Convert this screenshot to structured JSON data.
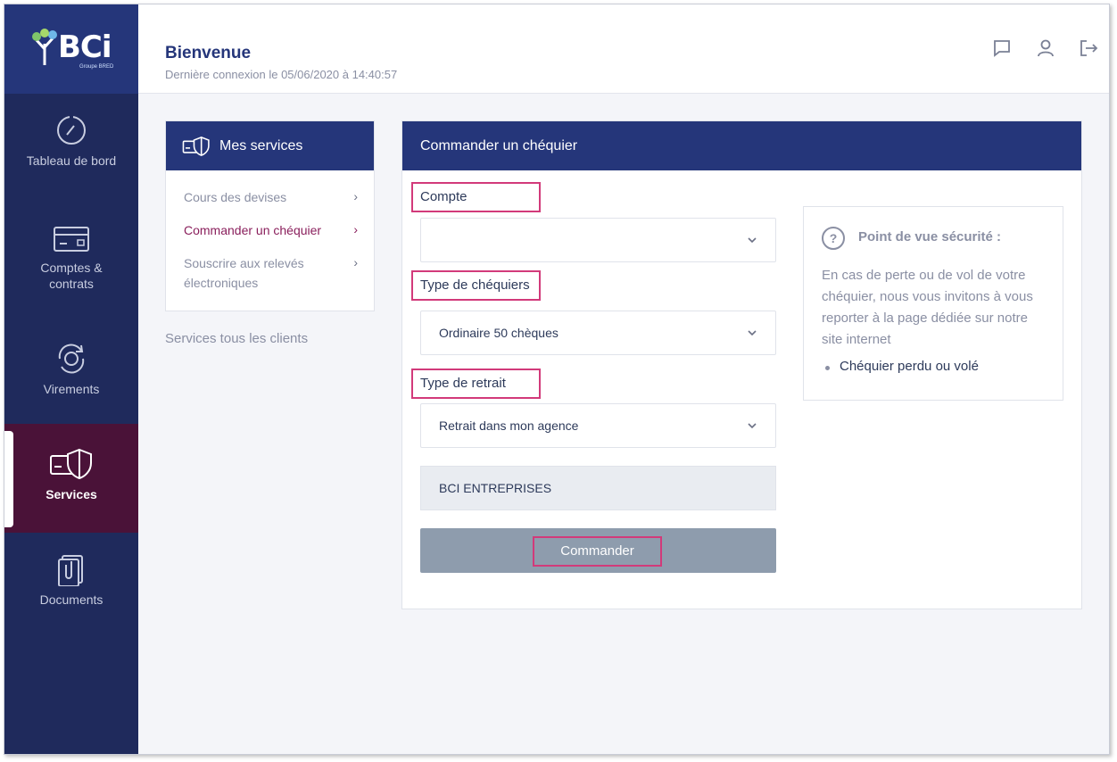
{
  "brand": {
    "logo_text": "BCi",
    "logo_sub": "Groupe BRED"
  },
  "sidebar": {
    "items": [
      {
        "label": "Tableau de bord",
        "icon": "gauge-icon"
      },
      {
        "label": "Comptes & contrats",
        "icon": "card-icon"
      },
      {
        "label": "Virements",
        "icon": "transfer-icon"
      },
      {
        "label": "Services",
        "icon": "services-shield-icon",
        "active": true
      },
      {
        "label": "Documents",
        "icon": "documents-clip-icon"
      }
    ]
  },
  "header": {
    "title": "Bienvenue",
    "last_login": "Dernière connexion le 05/06/2020 à 14:40:57",
    "icons": [
      "chat-icon",
      "user-icon",
      "logout-icon"
    ]
  },
  "services_menu": {
    "title": "Mes services",
    "links": [
      {
        "label": "Cours des devises"
      },
      {
        "label": "Commander un chéquier",
        "current": true
      },
      {
        "label": "Souscrire aux relevés électroniques"
      }
    ],
    "all_clients": "Services tous les clients"
  },
  "form": {
    "title": "Commander un chéquier",
    "compte_label": "Compte",
    "compte_value": "",
    "type_label": "Type de chéquiers",
    "type_value": "Ordinaire 50 chèques",
    "retrait_label": "Type de retrait",
    "retrait_value": "Retrait dans mon agence",
    "agency_value": "BCI ENTREPRISES",
    "submit_label": "Commander"
  },
  "security_tip": {
    "title": "Point de vue sécurité :",
    "text": "En cas de perte ou de vol de votre chéquier, nous vous invitons à vous reporter à la page dédiée sur notre site internet",
    "link": "Chéquier perdu ou volé"
  },
  "colors": {
    "navy": "#25367a",
    "sidebar": "#1f2a5c",
    "active": "#4a1238",
    "accent": "#d23a7a",
    "button": "#8e9cad"
  }
}
